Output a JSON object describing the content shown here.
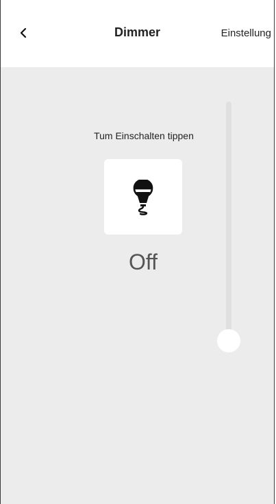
{
  "header": {
    "title": "Dimmer",
    "settings_label": "Einstellung",
    "back_icon": "chevron-left-icon"
  },
  "control": {
    "hint": "Tum Einschalten tippen",
    "state": "Off",
    "icon": "light-bulb-icon"
  },
  "slider": {
    "level_percent": 0
  },
  "colors": {
    "background": "#ececec",
    "tile": "#ffffff",
    "text": "#222222",
    "state_text": "#555555"
  }
}
